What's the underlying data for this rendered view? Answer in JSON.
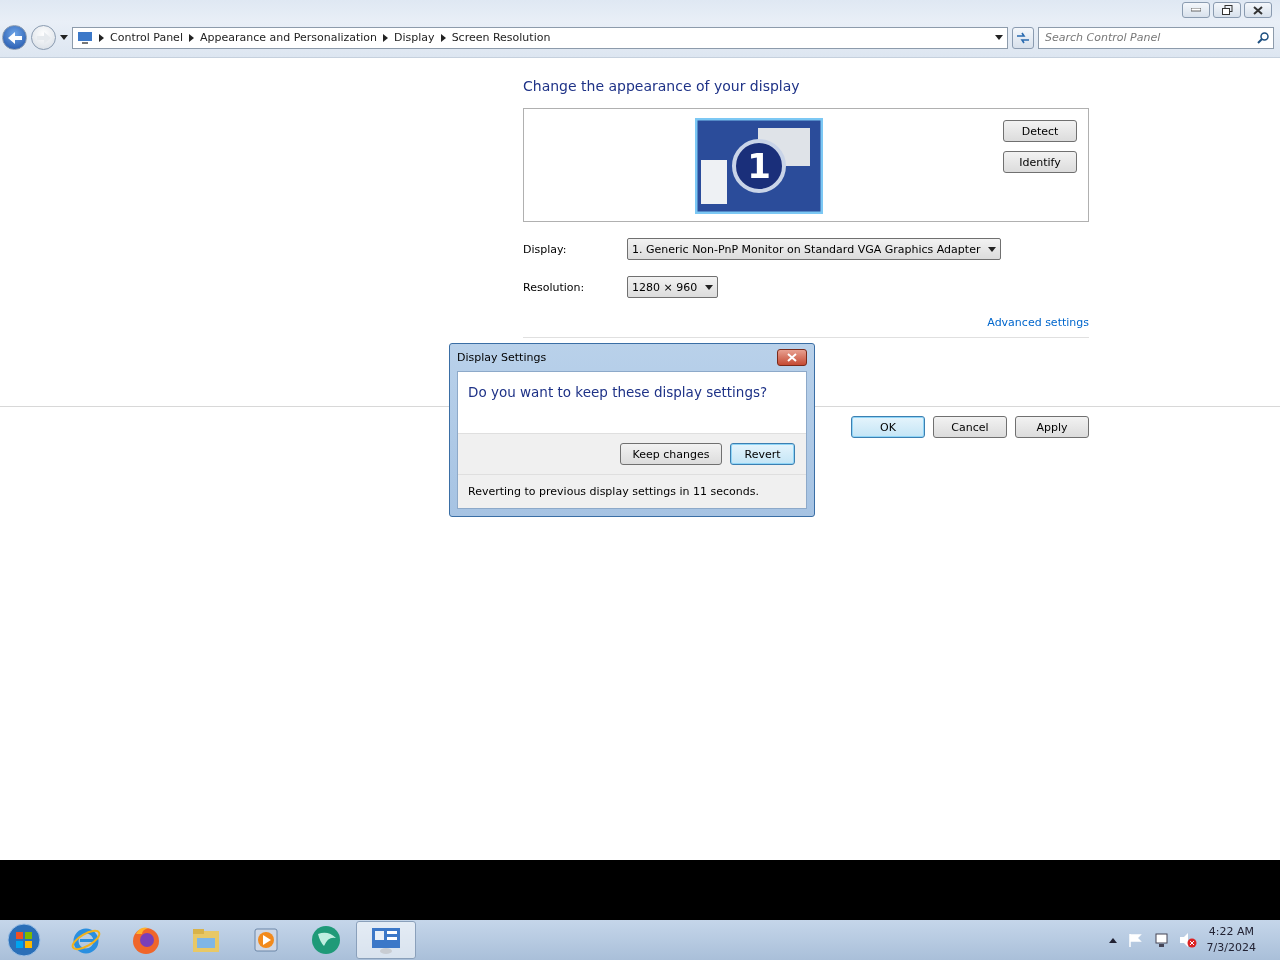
{
  "address_bar": {
    "breadcrumbs": [
      "Control Panel",
      "Appearance and Personalization",
      "Display",
      "Screen Resolution"
    ]
  },
  "search": {
    "placeholder": "Search Control Panel"
  },
  "page": {
    "heading": "Change the appearance of your display",
    "monitor_number": "1",
    "side_buttons": [
      "Detect",
      "Identify"
    ],
    "fields": [
      {
        "label": "Display:",
        "value": "1. Generic Non-PnP Monitor on Standard VGA Graphics Adapter"
      },
      {
        "label": "Resolution:",
        "value": "1280 × 960"
      }
    ],
    "link": "Advanced settings",
    "buttons": [
      {
        "label": "OK",
        "focused": true
      },
      {
        "label": "Cancel",
        "focused": false
      },
      {
        "label": "Apply",
        "focused": false
      }
    ]
  },
  "dialog": {
    "title": "Display Settings",
    "question": "Do you want to keep these display settings?",
    "buttons": [
      {
        "label": "Keep changes",
        "focused": false
      },
      {
        "label": "Revert",
        "focused": true
      }
    ],
    "status": "Reverting to previous display settings in 11 seconds."
  },
  "taskbar": {
    "apps": [
      {
        "kind": "ie",
        "selected": false
      },
      {
        "kind": "firefox",
        "selected": false
      },
      {
        "kind": "explorer",
        "selected": false
      },
      {
        "kind": "media",
        "selected": false
      },
      {
        "kind": "globe",
        "selected": false
      },
      {
        "kind": "control",
        "selected": true
      }
    ],
    "time": "4:22 AM",
    "date": "7/3/2024"
  }
}
